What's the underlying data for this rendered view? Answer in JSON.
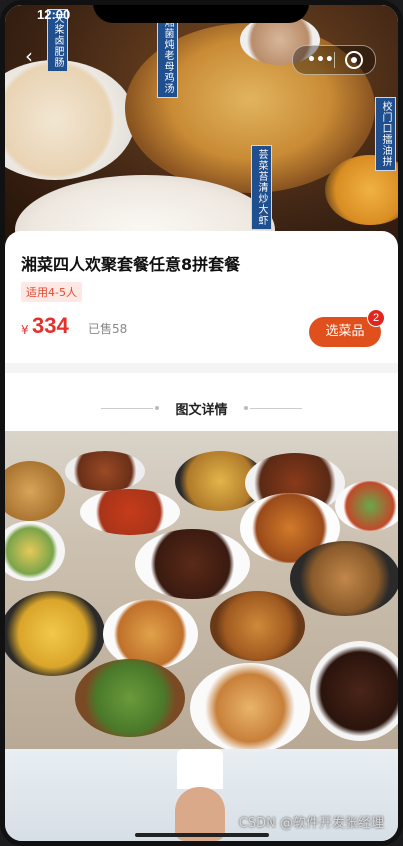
{
  "status_bar": {
    "time": "12:00"
  },
  "hero": {
    "tags": [
      "天桨卤肥肠",
      "湘菌炖老母鸡汤",
      "芸菜苔清炒大虾",
      "校门口擂油拼"
    ]
  },
  "product": {
    "title": "湘菜四人欢聚套餐任意8拼套餐",
    "badge": "适用4-5人",
    "currency": "¥",
    "price": "334",
    "sold": "已售58",
    "select_label": "选菜品",
    "select_count": "2"
  },
  "details": {
    "title": "图文详情"
  },
  "watermark": "CSDN @软件开发张经理",
  "colors": {
    "accent": "#e0501c",
    "price": "#e4322b"
  },
  "icons": [
    "back-icon",
    "more-dots-icon",
    "target-icon"
  ]
}
